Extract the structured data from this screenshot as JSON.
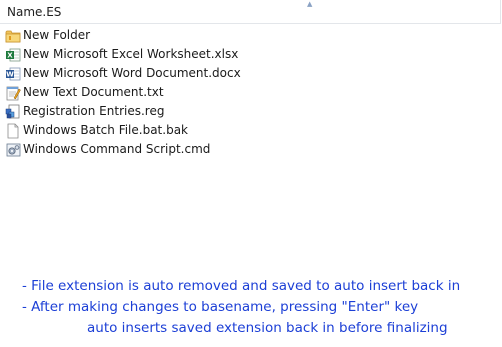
{
  "header": {
    "column_label": "Name.ES"
  },
  "files": [
    {
      "name": "New Folder",
      "icon": "folder-icon"
    },
    {
      "name": "New Microsoft Excel Worksheet.xlsx",
      "icon": "excel-file-icon"
    },
    {
      "name": "New Microsoft Word Document.docx",
      "icon": "word-file-icon"
    },
    {
      "name": "New Text Document.txt",
      "icon": "text-file-icon"
    },
    {
      "name": "Registration Entries.reg",
      "icon": "registry-file-icon"
    },
    {
      "name": "Windows Batch File.bat.bak",
      "icon": "blank-file-icon"
    },
    {
      "name": "Windows Command Script.cmd",
      "icon": "command-script-icon"
    }
  ],
  "notes": [
    "- File extension is auto removed and saved to auto insert back in",
    "- After making changes to basename, pressing \"Enter\" key",
    "auto inserts saved extension back in before finalizing"
  ],
  "colors": {
    "note_text": "#1c3fd6",
    "folder": "#e8b64a",
    "excel": "#1d7a3d",
    "word": "#2b5797"
  }
}
